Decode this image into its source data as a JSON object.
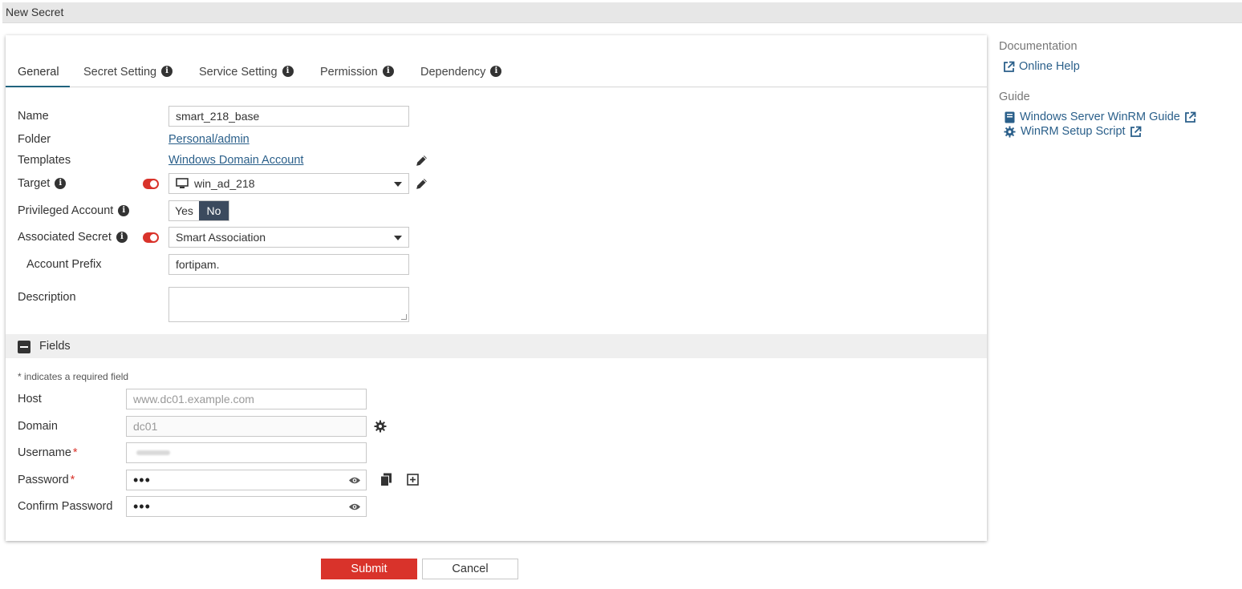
{
  "window": {
    "title": "New Secret"
  },
  "tabs": [
    {
      "label": "General",
      "active": true
    },
    {
      "label": "Secret Setting",
      "active": false
    },
    {
      "label": "Service Setting",
      "active": false
    },
    {
      "label": "Permission",
      "active": false
    },
    {
      "label": "Dependency",
      "active": false
    }
  ],
  "form": {
    "name": {
      "label": "Name",
      "value": "smart_218_base"
    },
    "folder": {
      "label": "Folder",
      "value": "Personal/admin"
    },
    "templates": {
      "label": "Templates",
      "value": "Windows Domain Account"
    },
    "target": {
      "label": "Target",
      "value": "win_ad_218"
    },
    "privileged": {
      "label": "Privileged Account",
      "yes": "Yes",
      "no": "No",
      "selected": "No"
    },
    "associated": {
      "label": "Associated Secret",
      "value": "Smart Association"
    },
    "prefix": {
      "label": "Account Prefix",
      "value": "fortipam."
    },
    "description": {
      "label": "Description",
      "value": ""
    }
  },
  "fields": {
    "title": "Fields",
    "required_hint": "* indicates a required field",
    "host": {
      "label": "Host",
      "placeholder": "www.dc01.example.com"
    },
    "domain": {
      "label": "Domain",
      "placeholder": "dc01"
    },
    "username": {
      "label": "Username",
      "required": "*"
    },
    "password": {
      "label": "Password",
      "required": "*",
      "mask": "•••"
    },
    "confirm": {
      "label": "Confirm Password",
      "mask": "•••"
    }
  },
  "actions": {
    "submit": "Submit",
    "cancel": "Cancel"
  },
  "sidebar": {
    "documentation": {
      "heading": "Documentation",
      "online_help": "Online Help"
    },
    "guide": {
      "heading": "Guide",
      "winrm_guide": "Windows Server WinRM Guide",
      "winrm_script": "WinRM Setup Script"
    }
  },
  "colors": {
    "accent": "#d9332b",
    "link": "#2a5f8a",
    "tab_underline": "#20647e",
    "segment_on": "#3b4a5e"
  },
  "icons": [
    "info-icon",
    "pencil-icon",
    "monitor-icon",
    "gear-icon",
    "eye-icon",
    "copy-icon",
    "plus-square-icon",
    "external-link-icon",
    "book-icon",
    "minus-square-icon"
  ]
}
